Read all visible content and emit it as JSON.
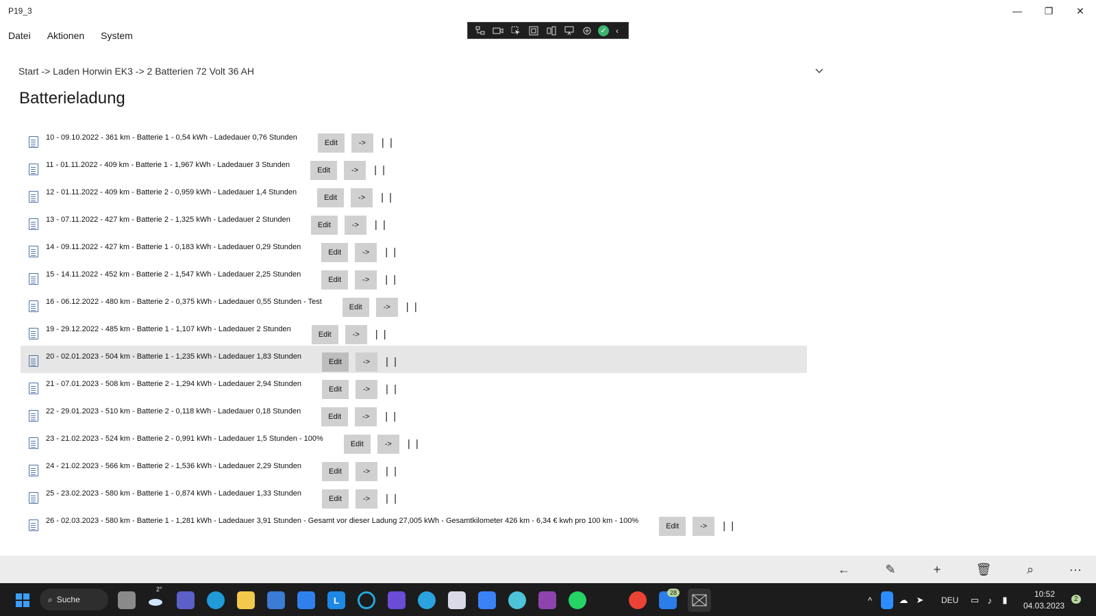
{
  "window": {
    "title": "P19_3",
    "minimize_glyph": "—",
    "restore_glyph": "❐",
    "close_glyph": "✕"
  },
  "menu": [
    {
      "label": "Datei"
    },
    {
      "label": "Aktionen"
    },
    {
      "label": "System"
    }
  ],
  "breadcrumb": "Start -> Laden Horwin EK3 -> 2 Batterien 72 Volt 36 AH",
  "page_title": "Batterieladung",
  "entries": [
    {
      "text": "10 - 09.10.2022 - 361 km - Batterie 1 - 0,54 kWh  - Ladedauer 0,76 Stunden",
      "edit": "Edit",
      "go": "->",
      "sep": "| |"
    },
    {
      "text": "11 - 01.11.2022 - 409 km - Batterie 1 - 1,967 kWh  - Ladedauer 3 Stunden",
      "edit": "Edit",
      "go": "->",
      "sep": "| |"
    },
    {
      "text": "12 - 01.11.2022 - 409 km - Batterie 2 - 0,959 kWh  - Ladedauer 1,4 Stunden",
      "edit": "Edit",
      "go": "->",
      "sep": "| |"
    },
    {
      "text": "13 - 07.11.2022 - 427 km - Batterie 2 - 1,325 kWh  - Ladedauer 2 Stunden",
      "edit": "Edit",
      "go": "->",
      "sep": "| |"
    },
    {
      "text": "14 - 09.11.2022 - 427 km - Batterie 1 - 0,183 kWh  - Ladedauer 0,29 Stunden",
      "edit": "Edit",
      "go": "->",
      "sep": "| |"
    },
    {
      "text": "15 - 14.11.2022 - 452 km - Batterie 2 - 1,547 kWh  - Ladedauer 2,25 Stunden",
      "edit": "Edit",
      "go": "->",
      "sep": "| |"
    },
    {
      "text": "16 - 06.12.2022 - 480 km - Batterie 2 - 0,375 kWh  - Ladedauer 0,55 Stunden  - Test",
      "edit": "Edit",
      "go": "->",
      "sep": "| |"
    },
    {
      "text": "19 - 29.12.2022 - 485 km - Batterie 1 - 1,107 kWh  - Ladedauer 2 Stunden",
      "edit": "Edit",
      "go": "->",
      "sep": "| |"
    },
    {
      "text": "20 - 02.01.2023 - 504 km - Batterie 1 - 1,235 kWh  - Ladedauer 1,83 Stunden",
      "edit": "Edit",
      "go": "->",
      "sep": "| |",
      "selected": true
    },
    {
      "text": "21 - 07.01.2023 - 508 km - Batterie 2 - 1,294 kWh  - Ladedauer 2,94 Stunden",
      "edit": "Edit",
      "go": "->",
      "sep": "| |"
    },
    {
      "text": "22 - 29.01.2023 - 510 km - Batterie 2 - 0,118 kWh  - Ladedauer 0,18 Stunden",
      "edit": "Edit",
      "go": "->",
      "sep": "| |"
    },
    {
      "text": "23 - 21.02.2023 - 524 km - Batterie 2 - 0,991 kWh  - Ladedauer 1,5 Stunden  - 100%",
      "edit": "Edit",
      "go": "->",
      "sep": "| |"
    },
    {
      "text": "24 - 21.02.2023 - 566 km - Batterie 2 - 1,536 kWh  - Ladedauer 2,29 Stunden",
      "edit": "Edit",
      "go": "->",
      "sep": "| |"
    },
    {
      "text": "25 - 23.02.2023 - 580 km - Batterie 1 - 0,874 kWh  - Ladedauer 1,33 Stunden",
      "edit": "Edit",
      "go": "->",
      "sep": "| |"
    },
    {
      "text": "26 - 02.03.2023 - 580 km - Batterie 1 - 1,281 kWh  - Ladedauer 3,91 Stunden  - Gesamt vor dieser Ladung 27,005 kWh  - Gesamtkilometer 426 km  - 6,34 € kwh pro 100 km  - 100%",
      "edit": "Edit",
      "go": "->",
      "sep": "| |"
    }
  ],
  "command_bar": [
    {
      "name": "back-arrow-icon",
      "glyph": "←"
    },
    {
      "name": "edit-pencil-icon",
      "glyph": "✎"
    },
    {
      "name": "add-plus-icon",
      "glyph": "+"
    },
    {
      "name": "delete-trash-icon",
      "glyph": "🗑"
    },
    {
      "name": "search-magnifier-icon",
      "glyph": "⌕"
    },
    {
      "name": "more-options-icon",
      "glyph": "···"
    }
  ],
  "taskbar": {
    "search_label": "Suche",
    "weather": "2°",
    "mail_badge": "28",
    "language": "DEU",
    "time": "10:52",
    "date": "04.03.2023",
    "notification_count": "2"
  },
  "colors": {
    "selected_row": "#e6e6e6",
    "button": "#d0d0d0",
    "taskbar": "#1c1c1c",
    "command_bar": "#ececec"
  }
}
